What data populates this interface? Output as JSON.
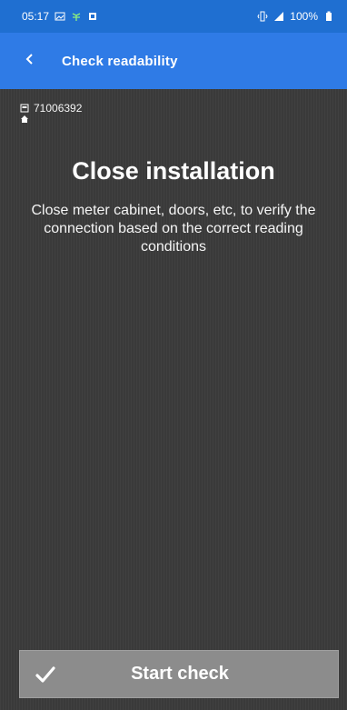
{
  "status_bar": {
    "time": "05:17",
    "left_icons": [
      "image-icon",
      "bug-icon",
      "screen-record-icon"
    ],
    "right_icons": [
      "vibrate-icon",
      "signal-icon"
    ],
    "battery_percent": "100%",
    "battery_icon": "battery-icon"
  },
  "app_bar": {
    "back_icon": "chevron-left-icon",
    "title": "Check readability"
  },
  "meta": {
    "meter_number": "71006392",
    "meter_icon": "meter-icon",
    "home_icon": "home-icon"
  },
  "main": {
    "title": "Close installation",
    "description": "Close meter cabinet, doors, etc, to verify the connection based on the correct reading conditions"
  },
  "bottom_action": {
    "icon": "check-icon",
    "label": "Start check"
  },
  "colors": {
    "status_bar": "#1f6fd1",
    "app_bar": "#2f7be6",
    "background": "#3a3a3a",
    "button": "#8c8c8c",
    "text": "#ffffff"
  }
}
